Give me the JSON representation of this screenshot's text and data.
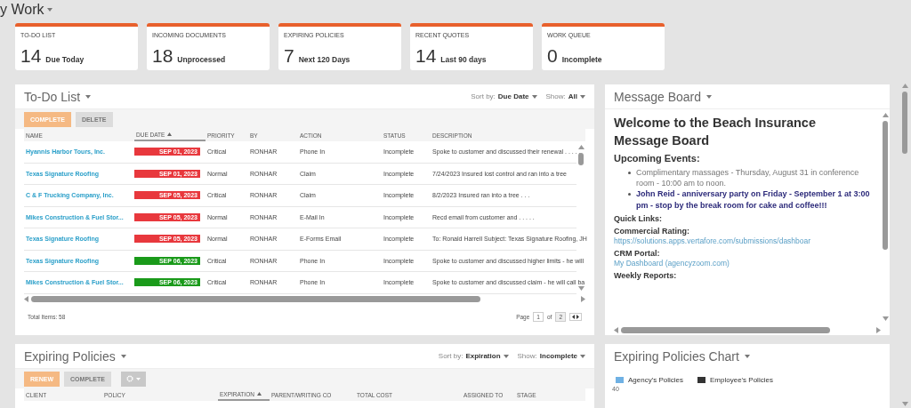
{
  "page_title": "y Work",
  "summary_tiles": [
    {
      "label": "TO-DO LIST",
      "count": "14",
      "caption": "Due Today"
    },
    {
      "label": "INCOMING DOCUMENTS",
      "count": "18",
      "caption": "Unprocessed"
    },
    {
      "label": "EXPIRING POLICIES",
      "count": "7",
      "caption": "Next 120 Days"
    },
    {
      "label": "RECENT QUOTES",
      "count": "14",
      "caption": "Last 90 days"
    },
    {
      "label": "WORK QUEUE",
      "count": "0",
      "caption": "Incomplete"
    }
  ],
  "todo_list": {
    "title": "To-Do List",
    "sort_label": "Sort by:",
    "sort_value": "Due Date",
    "show_label": "Show:",
    "show_value": "All",
    "buttons": [
      {
        "label": "COMPLETE",
        "kind": "primary"
      },
      {
        "label": "DELETE",
        "kind": "secondary"
      }
    ],
    "columns": [
      {
        "label": "NAME",
        "sorted": false
      },
      {
        "label": "DUE DATE",
        "sorted": true
      },
      {
        "label": "PRIORITY",
        "sorted": false
      },
      {
        "label": "BY",
        "sorted": false
      },
      {
        "label": "ACTION",
        "sorted": false
      },
      {
        "label": "STATUS",
        "sorted": false
      },
      {
        "label": "DESCRIPTION",
        "sorted": false
      }
    ],
    "rows": [
      {
        "name": "Hyannis Harbor Tours, Inc.",
        "due_date": "SEP 01, 2023",
        "color": "#e8383d",
        "priority": "Critical",
        "by": "RONHAR",
        "action": "Phone In",
        "status": "Incomplete",
        "description": "Spoke to customer and discussed their renewal . . . . ."
      },
      {
        "name": "Texas Signature Roofing",
        "due_date": "SEP 01, 2023",
        "color": "#e8383d",
        "priority": "Normal",
        "by": "RONHAR",
        "action": "Claim",
        "status": "Incomplete",
        "description": "7/24/2023 Insured lost control and ran into a tree"
      },
      {
        "name": "C & F Trucking Company, Inc.",
        "due_date": "SEP 05, 2023",
        "color": "#e8383d",
        "priority": "Critical",
        "by": "RONHAR",
        "action": "Claim",
        "status": "Incomplete",
        "description": "8/2/2023 Insured ran into a tree . . ."
      },
      {
        "name": "Mikes Construction & Fuel Stor...",
        "due_date": "SEP 05, 2023",
        "color": "#e8383d",
        "priority": "Normal",
        "by": "RONHAR",
        "action": "E-Mail In",
        "status": "Incomplete",
        "description": "Recd email from customer and . . . . ."
      },
      {
        "name": "Texas Signature Roofing",
        "due_date": "SEP 05, 2023",
        "color": "#e8383d",
        "priority": "Normal",
        "by": "RONHAR",
        "action": "E-Forms Email",
        "status": "Incomplete",
        "description": "To: Ronald Harrell Subject: Texas Signature Roofing, JH"
      },
      {
        "name": "Texas Signature Roofing",
        "due_date": "SEP 06, 2023",
        "color": "#1a9a1a",
        "priority": "Critical",
        "by": "RONHAR",
        "action": "Phone In",
        "status": "Incomplete",
        "description": "Spoke to customer and discussed higher limits - he will"
      },
      {
        "name": "Mikes Construction & Fuel Stor...",
        "due_date": "SEP 06, 2023",
        "color": "#1a9a1a",
        "priority": "Critical",
        "by": "RONHAR",
        "action": "Phone In",
        "status": "Incomplete",
        "description": "Spoke to customer and discussed claim - he will call ba"
      }
    ],
    "total_items": "Total Items: 58",
    "pager": {
      "label": "Page",
      "current": "1",
      "of": "of",
      "total": "2"
    }
  },
  "message_board": {
    "title": "Message Board",
    "heading": "Welcome to the Beach Insurance Message Board",
    "events_heading": "Upcoming Events:",
    "events": [
      {
        "text": "Complimentary massages - Thursday, August 31 in conference room - 10:00 am to noon.",
        "highlight": false
      },
      {
        "text": "John Reid - anniversary party on Friday - September 1 at 3:00 pm - stop by the break room for cake and coffee!!!",
        "highlight": true
      }
    ],
    "quick_links_heading": "Quick Links:",
    "links": [
      {
        "label": "Commercial Rating:",
        "url": "https://solutions.apps.vertafore.com/submissions/dashboar"
      },
      {
        "label": "CRM Portal:",
        "url": "My Dashboard (agencyzoom.com)"
      }
    ],
    "weekly_heading": "Weekly Reports:"
  },
  "expiring_policies": {
    "title": "Expiring Policies",
    "sort_label": "Sort by:",
    "sort_value": "Expiration",
    "show_label": "Show:",
    "show_value": "Incomplete",
    "buttons": [
      {
        "label": "RENEW",
        "kind": "primary"
      },
      {
        "label": "COMPLETE",
        "kind": "secondary"
      }
    ],
    "columns": [
      {
        "label": "CLIENT",
        "sorted": false
      },
      {
        "label": "POLICY",
        "sorted": false
      },
      {
        "label": "EXPIRATION",
        "sorted": true
      },
      {
        "label": "PARENT/WRITING CO",
        "sorted": false
      },
      {
        "label": "TOTAL COST",
        "sorted": false
      },
      {
        "label": "ASSIGNED TO",
        "sorted": false
      },
      {
        "label": "STAGE",
        "sorted": false
      }
    ]
  },
  "expiring_chart": {
    "title": "Expiring Policies Chart",
    "legend": [
      {
        "label": "Agency's Policies",
        "color": "#6fb1e4"
      },
      {
        "label": "Employee's Policies",
        "color": "#333333"
      }
    ],
    "axis_tick": "40"
  }
}
